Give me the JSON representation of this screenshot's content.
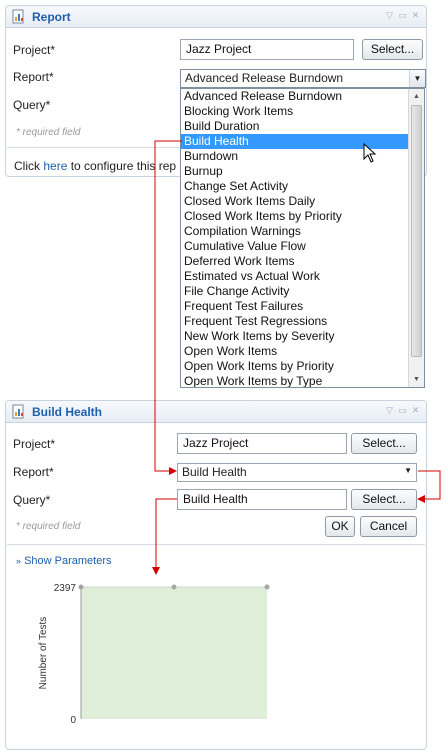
{
  "top_panel": {
    "title": "Report",
    "project_label": "Project*",
    "project_value": "Jazz Project",
    "select_button": "Select...",
    "report_label": "Report*",
    "report_value": "Advanced Release Burndown",
    "query_label": "Query*",
    "required_hint": "* required field",
    "footer_prefix": "Click ",
    "footer_link": "here",
    "footer_suffix": " to configure this rep",
    "dropdown_items": [
      "Advanced Release Burndown",
      "Blocking Work Items",
      "Build Duration",
      "Build Health",
      "Burndown",
      "Burnup",
      "Change Set Activity",
      "Closed Work Items Daily",
      "Closed Work Items by Priority",
      "Compilation Warnings",
      "Cumulative Value Flow",
      "Deferred Work Items",
      "Estimated vs Actual Work",
      "File Change Activity",
      "Frequent Test Failures",
      "Frequent Test Regressions",
      "New Work Items by Severity",
      "Open Work Items",
      "Open Work Items by Priority",
      "Open Work Items by Type"
    ],
    "selected_index": 3
  },
  "bottom_panel": {
    "title": "Build Health",
    "project_label": "Project*",
    "project_value": "Jazz Project",
    "select_button": "Select...",
    "report_label": "Report*",
    "report_value": "Build Health",
    "query_label": "Query*",
    "query_value": "Build Health",
    "query_select_button": "Select...",
    "required_hint": "* required field",
    "ok_button": "OK",
    "cancel_button": "Cancel",
    "show_parameters": "Show Parameters"
  },
  "chart_data": {
    "type": "area",
    "ylabel": "Number of Tests",
    "ylim": [
      0,
      2397
    ],
    "yticks": [
      "2397",
      "0"
    ],
    "x": [
      0,
      1,
      2
    ],
    "values": [
      2397,
      2397,
      2397
    ],
    "fill": "#deeed8",
    "point_color": "#a7a7a7",
    "grid": false
  },
  "colors": {
    "title_blue": "#1f5fae",
    "selection_blue": "#3399ff",
    "annotation_red": "#d40000"
  },
  "icons": {
    "panel_icon": "report-icon",
    "cursor": "mouse-pointer-icon"
  }
}
